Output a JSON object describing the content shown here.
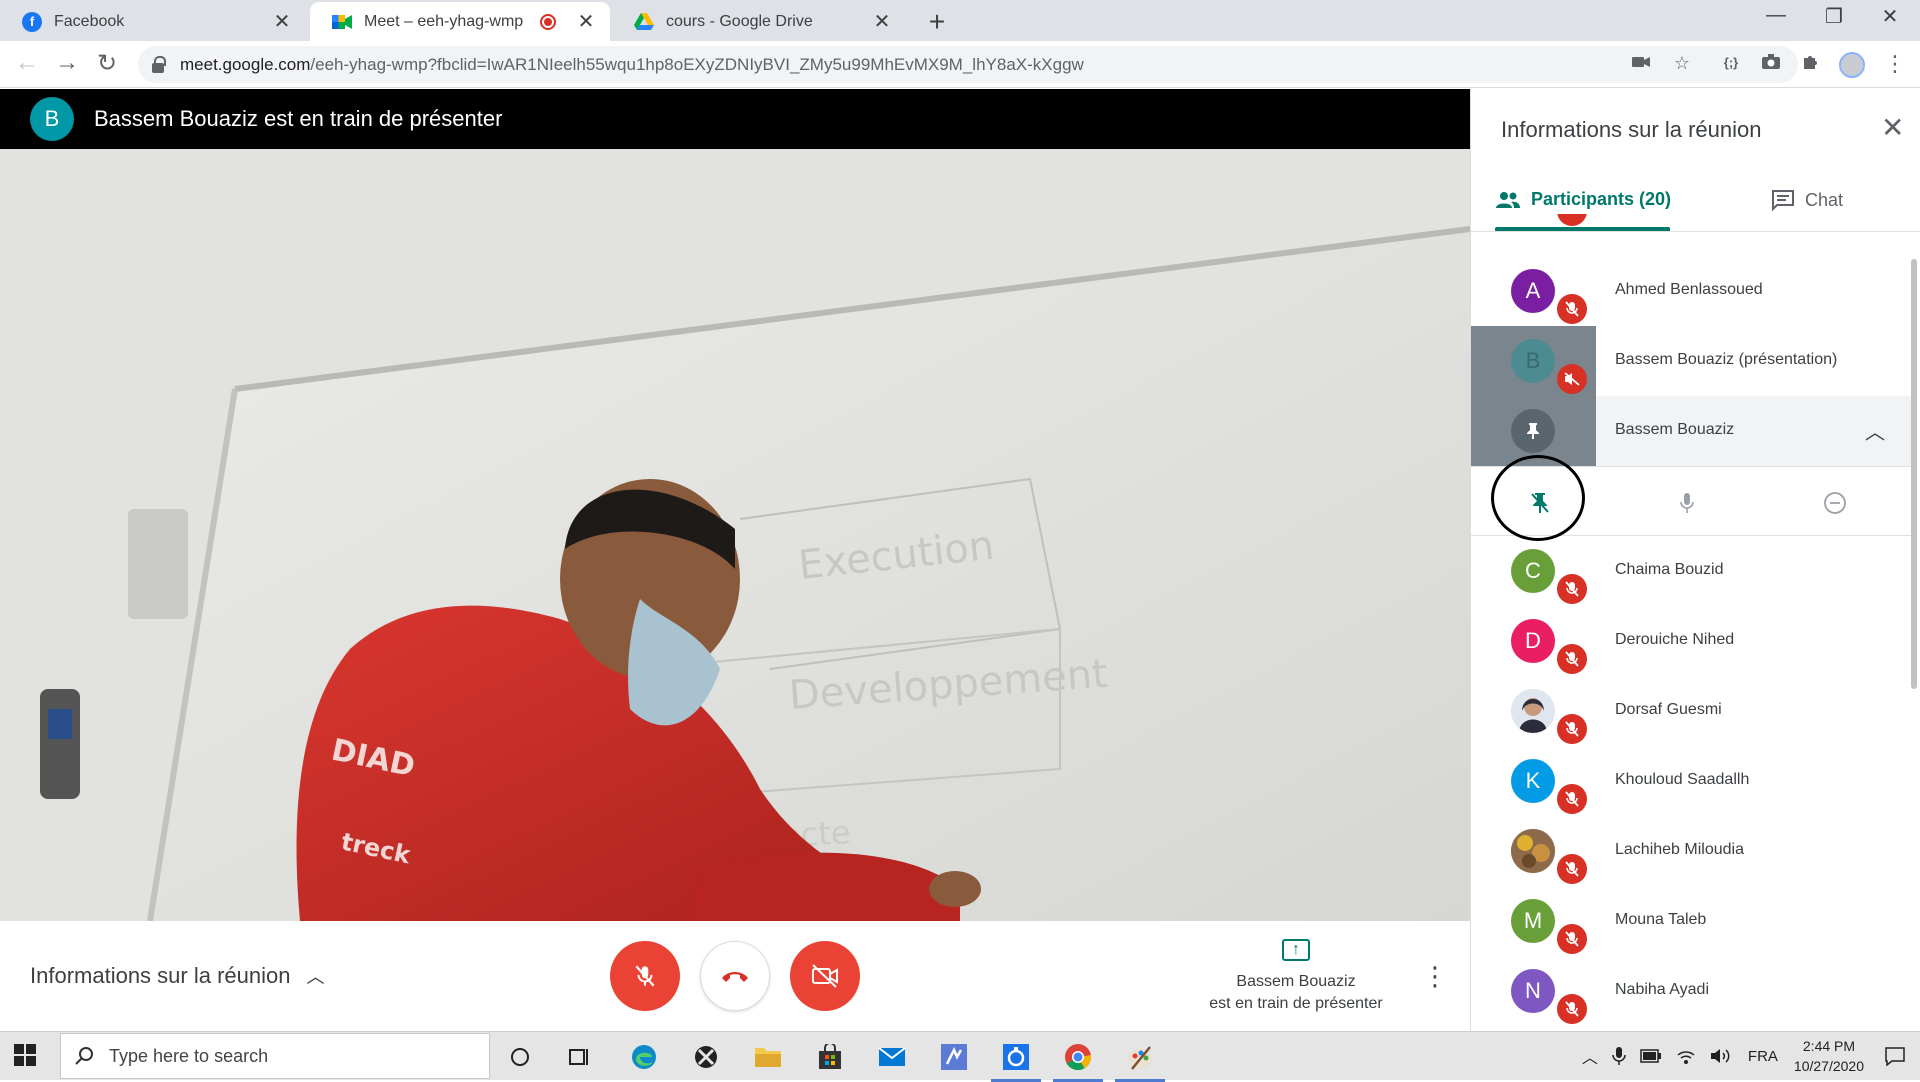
{
  "browser": {
    "tabs": [
      {
        "label": "Facebook",
        "icon": "facebook-icon"
      },
      {
        "label": "Meet – eeh-yhag-wmp",
        "icon": "google-meet-icon",
        "recording": true
      },
      {
        "label": "cours - Google Drive",
        "icon": "google-drive-icon"
      }
    ],
    "url_host": "meet.google.com",
    "url_path": "/eeh-yhag-wmp?fbclid=IwAR1NIeelh55wqu1hp8oEXyZDNIyBVI_ZMy5u99MhEvMX9M_lhY8aX-kXggw"
  },
  "presenter_bar": {
    "avatar_letter": "B",
    "avatar_color": "#0097a7",
    "text": "Bassem Bouaziz est en train de présenter"
  },
  "bottom_bar": {
    "meeting_info_label": "Informations sur la réunion",
    "presenting_name": "Bassem Bouaziz",
    "presenting_status": "est en train de présenter"
  },
  "side_panel": {
    "title": "Informations sur la réunion",
    "tab_participants": "Participants (20)",
    "tab_chat": "Chat",
    "participants": [
      {
        "name": "Ahmed Benlassoued",
        "initial": "A",
        "color": "#7b1fa2"
      },
      {
        "name": "Bassem Bouaziz (présentation)",
        "initial": "B",
        "color": "#0097a7"
      },
      {
        "name": "Bassem Bouaziz",
        "initial": "",
        "color": "#0097a7"
      },
      {
        "name": "Chaima Bouzid",
        "initial": "C",
        "color": "#689f38"
      },
      {
        "name": "Derouiche Nihed",
        "initial": "D",
        "color": "#e91e63"
      },
      {
        "name": "Dorsaf Guesmi",
        "initial": "",
        "color": "#5c6b8a"
      },
      {
        "name": "Khouloud Saadallh",
        "initial": "K",
        "color": "#039be5"
      },
      {
        "name": "Lachiheb Miloudia",
        "initial": "",
        "color": "#a07850"
      },
      {
        "name": "Mouna Taleb",
        "initial": "M",
        "color": "#689f38"
      },
      {
        "name": "Nabiha Ayadi",
        "initial": "N",
        "color": "#7e57c2"
      }
    ]
  },
  "taskbar": {
    "search_placeholder": "Type here to search",
    "language": "FRA",
    "time": "2:44 PM",
    "date": "10/27/2020"
  },
  "colors": {
    "meet_teal": "#00796b",
    "danger_red": "#ea4335",
    "muted_badge": "#d93025"
  }
}
